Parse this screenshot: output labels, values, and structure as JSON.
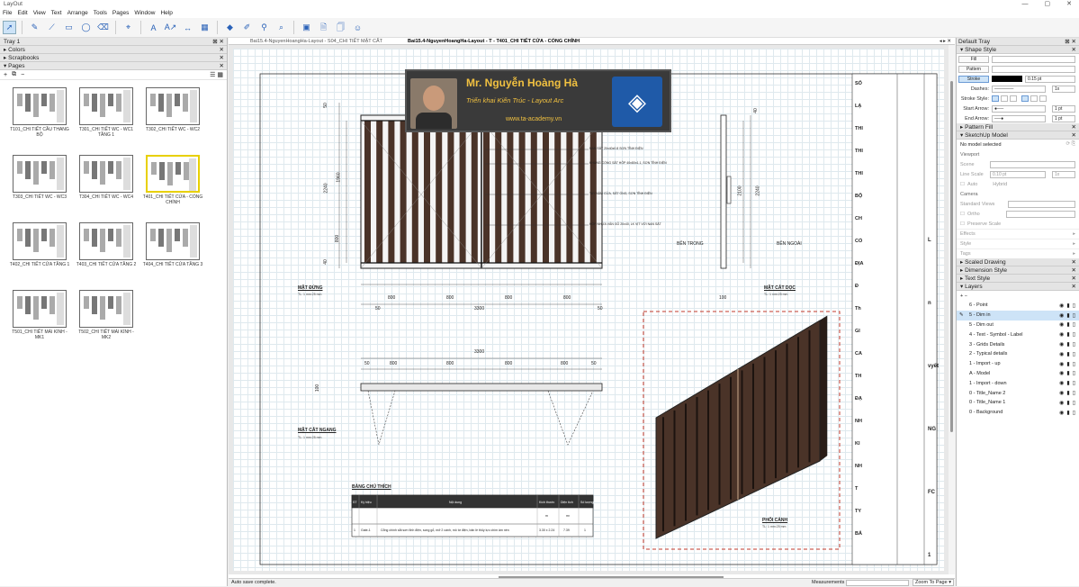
{
  "app": {
    "title": "LayOut",
    "window_controls": [
      "—",
      "▢",
      "✕"
    ]
  },
  "menu": [
    "File",
    "Edit",
    "View",
    "Text",
    "Arrange",
    "Tools",
    "Pages",
    "Window",
    "Help"
  ],
  "toolbar": {
    "icons": [
      "select-icon",
      "pencil-icon",
      "line-icon",
      "rectangle-icon",
      "circle-icon",
      "eraser-icon",
      "sample-icon",
      "text-icon",
      "label-icon",
      "dimension-icon",
      "table-icon",
      "split-icon",
      "join-icon",
      "style-icon",
      "zoom-icon",
      "present-icon",
      "add-page-icon",
      "duplicate-page-icon",
      "user-icon"
    ]
  },
  "left_tray": {
    "title": "Tray 1",
    "panels": [
      "Colors",
      "Scrapbooks",
      "Pages"
    ],
    "pages": [
      {
        "label": "T101_CHI TIẾT CẦU THANG BỘ"
      },
      {
        "label": "T301_CHI TIẾT WC - WC1 TẦNG 1"
      },
      {
        "label": "T302_CHI TIẾT WC - WC2"
      },
      {
        "label": "T303_CHI TIẾT WC - WC3"
      },
      {
        "label": "T304_CHI TIẾT WC - WC4"
      },
      {
        "label": "T401_CHI TIẾT CỬA - CỔNG CHÍNH",
        "selected": true
      },
      {
        "label": "T402_CHI TIẾT CỬA TẦNG 1"
      },
      {
        "label": "T403_CHI TIẾT CỬA TẦNG 2"
      },
      {
        "label": "T404_CHI TIẾT CỬA TẦNG 3"
      },
      {
        "label": "T501_CHI TIẾT MÁI KÍNH - MK1"
      },
      {
        "label": "T502_CHI TIẾT MÁI KÍNH - MK2"
      }
    ]
  },
  "tabs": [
    {
      "label": "Bai15.4-NguyenHoangHa-Layout - S04_CHI TIẾT MẶT CẮT"
    },
    {
      "label": "Bai15.4-NguyenHoangHa-Layout - T - T401_CHI TIẾT CỬA - CỔNG CHÍNH"
    }
  ],
  "overlay": {
    "name": "Mr. Nguyễn Hoàng Hà",
    "subtitle": "Triển khai Kiến Trúc - Layout Arc",
    "url": "www.ta-academy.vn"
  },
  "drawing": {
    "dims_top": [
      "800",
      "800",
      "800",
      "800"
    ],
    "dim_total": "3300",
    "dim_50": "50",
    "dims_left": [
      "50",
      "2240",
      "1960",
      "800",
      "40"
    ],
    "notes": [
      "NAN SẮT 20x40x0.8 SƠN TĨNH ĐIỆN",
      "KHUNG CỔNG SẮT HỘP 40x80x1.1, SƠN TĨNH ĐIỆN",
      "TAY NẮM CỬA, SẮT ỐNG, SƠN TĨNH ĐIỆN",
      "HỘP NHỰA VÂN GỖ 20x40, LK VỊT VỚI NAN SẮT"
    ],
    "front_title": "MẶT ĐỨNG",
    "front_scale": "TL: 1 mm:25 mm",
    "side_title": "MẶT CẮT DỌC",
    "side_scale": "TL: 1 mm:25 mm",
    "side_dims": [
      "2100",
      "2240",
      "40",
      "100"
    ],
    "inside": "BÊN TRONG",
    "outside": "BÊN NGOÀI",
    "plan_title": "MẶT CẮT NGANG",
    "plan_scale": "TL: 1 mm:25 mm",
    "plan_dim_left": "100",
    "persp_title": "PHỐI CẢNH",
    "persp_scale": "TL: 1 mm:25 mm",
    "legend_title": "BẢNG CHÚ THÍCH",
    "legend_headers": [
      "ST",
      "Ký hiệu",
      "Nội dung",
      "Kích thước",
      "Diện tích",
      "Số lượng"
    ],
    "legend_units": [
      "m",
      "m²"
    ],
    "legend_row": [
      "1",
      "Gate-1",
      "Cổng chính sắt sơn tĩnh điện, song gỗ, mở 2 cánh, mô tơ điện, bản lề thủy lực chìm âm nền",
      "3.30 x 2.24",
      "7.39",
      "1"
    ]
  },
  "status": {
    "left": "Auto save complete.",
    "measurements_label": "Measurements",
    "zoom": "Zoom To Page"
  },
  "right_tray": {
    "title": "Default Tray",
    "shape_style": {
      "title": "Shape Style",
      "fill": "Fill",
      "pattern": "Pattern",
      "stroke": "Stroke",
      "stroke_value": "0.15 pt",
      "dashes_label": "Dashes:",
      "dashes_value": "1x",
      "stroke_style_label": "Stroke Style:",
      "start_arrow_label": "Start Arrow:",
      "start_arrow_value": "1 pt",
      "end_arrow_label": "End Arrow:",
      "end_arrow_value": "1 pt"
    },
    "pattern_fill": "Pattern Fill",
    "sketchup_model": {
      "title": "SketchUp Model",
      "no_model": "No model selected",
      "viewport": "Viewport",
      "scene": "Scene",
      "line_scale": "Line Scale",
      "line_scale_value": "0.10 pt",
      "line_scale_mult": "1x",
      "auto": "Auto",
      "hybrid": "Hybrid",
      "camera": "Camera",
      "standard_views": "Standard Views",
      "ortho": "Ortho",
      "preserve_scale": "Preserve Scale",
      "effects": "Effects",
      "style": "Style",
      "tags": "Tags"
    },
    "collapsed": [
      "Scaled Drawing",
      "Dimension Style",
      "Text Style"
    ],
    "layers_title": "Layers",
    "layers": [
      {
        "name": "6 - Point"
      },
      {
        "name": "5 - Dim in",
        "selected": true
      },
      {
        "name": "5 - Dim out"
      },
      {
        "name": "4 - Text - Symbol - Label"
      },
      {
        "name": "3 - Grids Details"
      },
      {
        "name": "2 - Typical details"
      },
      {
        "name": "1 - Import - up"
      },
      {
        "name": "A - Model"
      },
      {
        "name": "1 - Import - down"
      },
      {
        "name": "0 - Title_Name 2"
      },
      {
        "name": "0 - Title_Name 1"
      },
      {
        "name": "0 - Background"
      }
    ]
  },
  "titleblock": {
    "chars": [
      "SỐ",
      "LẠ",
      "THI",
      "THI",
      "THI",
      "BỘ",
      "CH",
      "CỔ",
      "ĐỊA",
      "Đ",
      "Th",
      "GI",
      "CA",
      "TH",
      "ĐẠ",
      "NH",
      "KI",
      "NH",
      "T",
      "TY",
      "BẢ"
    ],
    "right_chars": [
      "L",
      "n",
      "vyết",
      "NG",
      "FC",
      "1"
    ]
  },
  "colors": {
    "accent": "#2a62b8",
    "select": "#cde3f7",
    "red_frame": "#c0392b",
    "wood": "#4a3328"
  }
}
